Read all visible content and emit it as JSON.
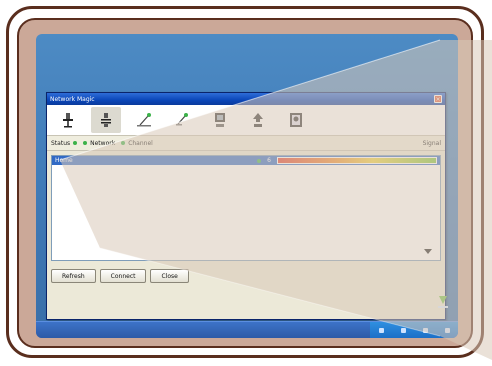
{
  "window": {
    "title": "Network Magic",
    "close_glyph": "×"
  },
  "toolbar": {
    "buttons": [
      {
        "name": "connect",
        "icon": "network-connect-icon"
      },
      {
        "name": "disconnect",
        "icon": "network-disconnect-icon"
      },
      {
        "name": "wireless",
        "icon": "wireless-icon"
      },
      {
        "name": "wireless-scan",
        "icon": "wireless-scan-icon"
      },
      {
        "name": "computer",
        "icon": "computer-icon"
      },
      {
        "name": "transfer",
        "icon": "transfer-icon"
      },
      {
        "name": "help",
        "icon": "help-icon"
      }
    ]
  },
  "infobar": {
    "items": [
      "Status",
      "Network",
      "Channel",
      "Signal"
    ]
  },
  "list": {
    "selected_row": {
      "name": "Home",
      "channel": "6",
      "signal_fraction": 0.85
    }
  },
  "buttons": {
    "left": "Refresh",
    "middle": "Connect",
    "right": "Close"
  },
  "colors": {
    "frame": "#5a2e1e",
    "titlebar": "#0b46b8",
    "selection": "#316ac5"
  }
}
